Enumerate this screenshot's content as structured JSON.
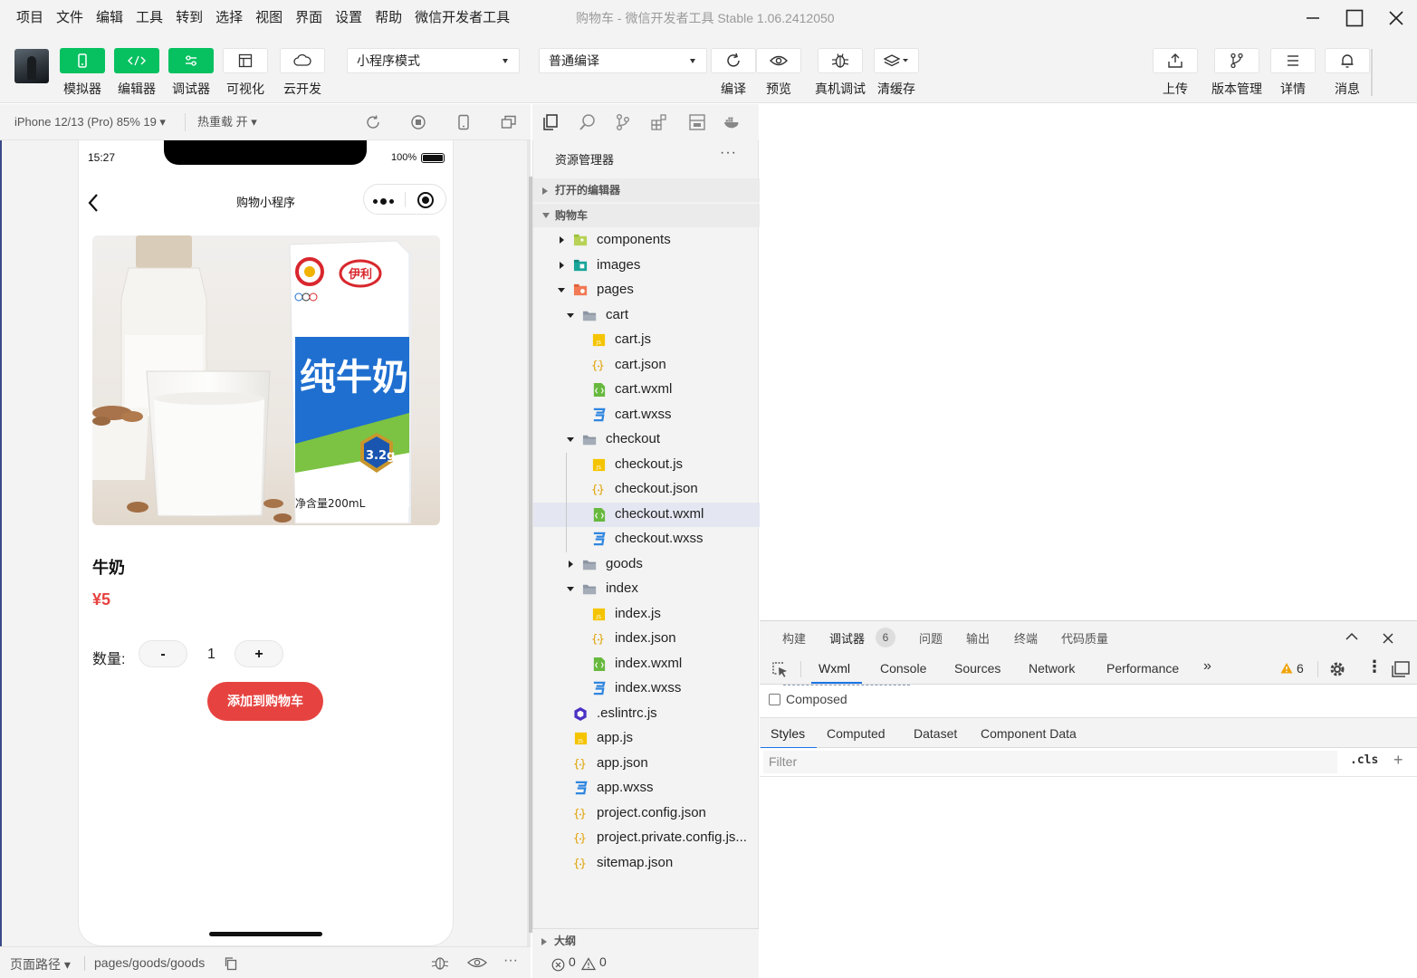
{
  "menu": [
    "项目",
    "文件",
    "编辑",
    "工具",
    "转到",
    "选择",
    "视图",
    "界面",
    "设置",
    "帮助",
    "微信开发者工具"
  ],
  "window_title": "购物车 - 微信开发者工具 Stable 1.06.2412050",
  "toolbar": {
    "simulator": "模拟器",
    "editor": "编辑器",
    "debugger": "调试器",
    "visual": "可视化",
    "cloud": "云开发",
    "mode_select": "小程序模式",
    "compile_select": "普通编译",
    "compile": "编译",
    "preview": "预览",
    "real_debug": "真机调试",
    "clear_cache": "清缓存",
    "upload": "上传",
    "version": "版本管理",
    "details": "详情",
    "messages": "消息"
  },
  "simbar": {
    "device": "iPhone 12/13 (Pro) 85% 19 ▾",
    "hot_reload": "热重载 开 ▾"
  },
  "phone": {
    "time": "15:27",
    "battery": "100%",
    "nav_title": "购物小程序",
    "product_name": "牛奶",
    "price": "¥5",
    "qty_label": "数量:",
    "minus": "-",
    "qty": "1",
    "plus": "+",
    "add_button": "添加到购物车",
    "package_text": {
      "brand": "伊利",
      "product": "纯牛奶",
      "protein": "3.2g",
      "volume": "净含量200mL"
    }
  },
  "sim_footer": {
    "path_label": "页面路径 ▾",
    "path": "pages/goods/goods"
  },
  "explorer": {
    "header": "资源管理器",
    "more": "···",
    "open_editors": "打开的编辑器",
    "project": "购物车",
    "items": [
      "components",
      "images",
      "pages",
      "cart",
      "cart.js",
      "cart.json",
      "cart.wxml",
      "cart.wxss",
      "checkout",
      "checkout.js",
      "checkout.json",
      "checkout.wxml",
      "checkout.wxss",
      "goods",
      "index",
      "index.js",
      "index.json",
      "index.wxml",
      "index.wxss",
      ".eslintrc.js",
      "app.js",
      "app.json",
      "app.wxss",
      "project.config.json",
      "project.private.config.js...",
      "sitemap.json"
    ],
    "outline": "大纲",
    "footer_errors": "0",
    "footer_warnings": "0"
  },
  "devtools": {
    "tabs": [
      "构建",
      "调试器",
      "问题",
      "输出",
      "终端",
      "代码质量"
    ],
    "badge": "6",
    "subtabs": [
      "Wxml",
      "Console",
      "Sources",
      "Network",
      "Performance"
    ],
    "warnings": "6",
    "composed": "Composed",
    "style_tabs": [
      "Styles",
      "Computed",
      "Dataset",
      "Component Data"
    ],
    "filter_placeholder": "Filter",
    "cls": ".cls",
    "plus": "+"
  },
  "colors": {
    "accent_green": "#07c160",
    "price_red": "#e64340",
    "devtools_blue": "#1a73e8"
  }
}
